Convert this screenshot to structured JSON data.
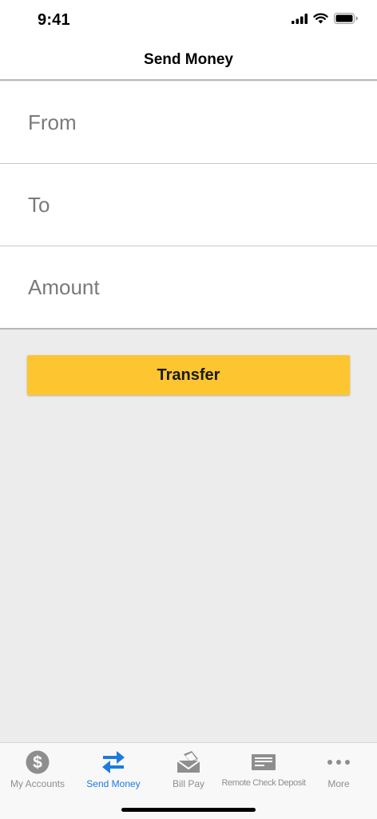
{
  "status_bar": {
    "time": "9:41"
  },
  "header": {
    "title": "Send Money"
  },
  "form": {
    "from_placeholder": "From",
    "to_placeholder": "To",
    "amount_placeholder": "Amount"
  },
  "actions": {
    "transfer_label": "Transfer"
  },
  "tab_bar": {
    "active_color": "#1c7ae0",
    "inactive_color": "#8e8e8e",
    "items": [
      {
        "label": "My Accounts",
        "icon": "dollar-circle-icon"
      },
      {
        "label": "Send Money",
        "icon": "transfer-arrows-icon",
        "active": true
      },
      {
        "label": "Bill Pay",
        "icon": "bill-envelope-icon"
      },
      {
        "label": "Remote Check Deposit",
        "icon": "check-icon"
      },
      {
        "label": "More",
        "icon": "more-dots-icon"
      }
    ]
  },
  "colors": {
    "accent": "#fdc52f",
    "background": "#ececec"
  }
}
